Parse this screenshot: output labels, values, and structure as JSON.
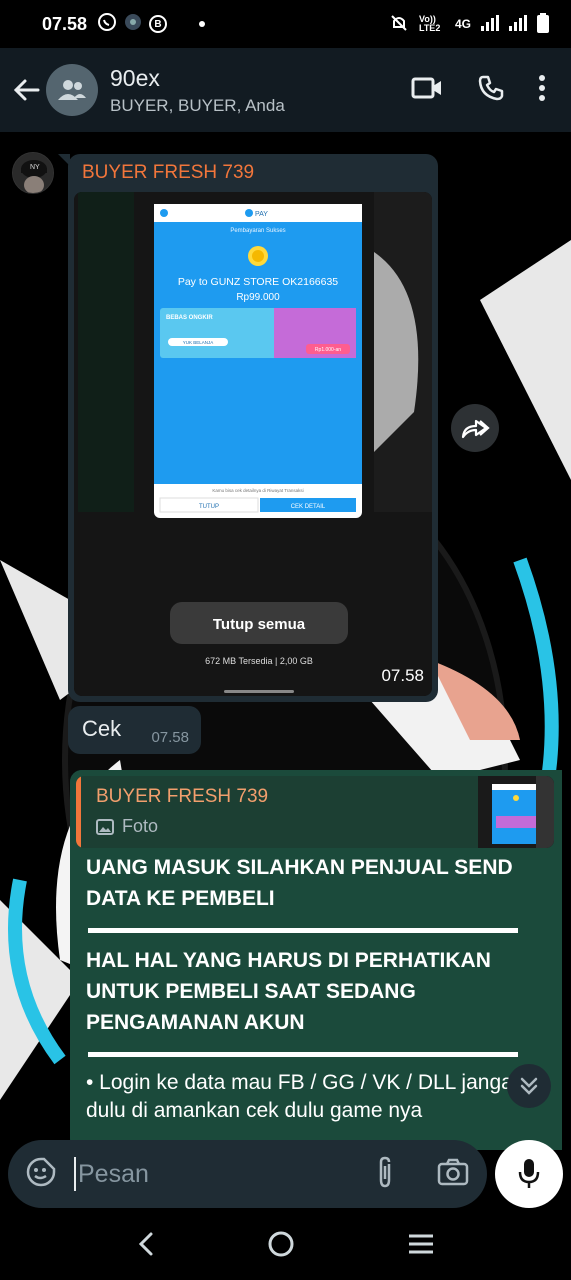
{
  "status_bar": {
    "time": "07.58",
    "network_label": "4G",
    "volte_label": "Vo)) LTE2"
  },
  "header": {
    "title": "90ex",
    "subtitle": "BUYER, BUYER, Anda"
  },
  "messages": {
    "photo_message": {
      "sender": "BUYER FRESH 739",
      "time": "07.58",
      "screenshot": {
        "pay_label": "PAY",
        "success_label": "Pembayaran Sukses",
        "pay_to": "Pay to GUNZ STORE OK2166635",
        "amount": "Rp99.000",
        "promo": "BEBAS ONGKIR",
        "promo_sub": "YUK BELANJA",
        "promo_price": "Rp1.000-an",
        "footer_note": "Kamu bisa cek detailnya di Riwayat Transaksi",
        "btn_close": "TUTUP",
        "btn_detail": "CEK DETAIL",
        "close_all": "Tutup semua",
        "memory": "672 MB Tersedia | 2,00 GB"
      }
    },
    "text_message": {
      "text": "Cek",
      "time": "07.58"
    },
    "reply_message": {
      "quoted_sender": "BUYER FRESH 739",
      "quoted_type": "Foto",
      "para1": "UANG MASUK SILAHKAN PENJUAL SEND DATA KE PEMBELI",
      "para2": "HAL HAL YANG HARUS DI PERHATIKAN UNTUK PEMBELI SAAT SEDANG PENGAMANAN AKUN",
      "para3": "• Login ke data mau FB / GG / VK / DLL jangan dulu di amankan cek dulu game nya"
    }
  },
  "composer": {
    "placeholder": "Pesan"
  },
  "colors": {
    "header_bg": "#121b22",
    "bubble_in": "#1f2c34",
    "bubble_out": "#1b4a3b",
    "sender_name": "#f2763b",
    "accent_blue": "#1e9bf0"
  }
}
